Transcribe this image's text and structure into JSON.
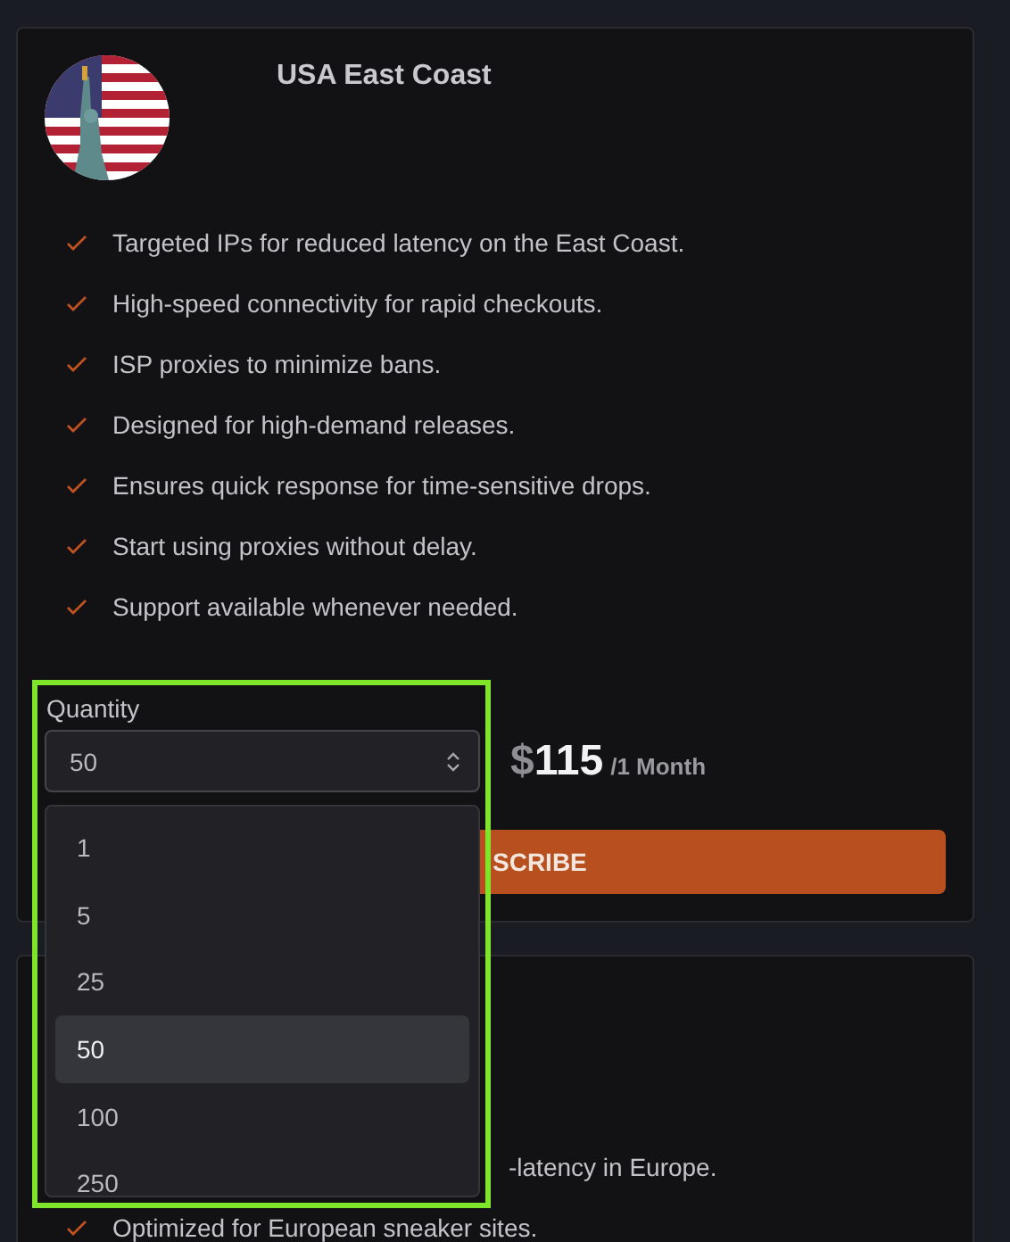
{
  "plan": {
    "title": "USA East Coast",
    "features": [
      "Targeted IPs for reduced latency on the East Coast.",
      "High-speed connectivity for rapid checkouts.",
      "ISP proxies to minimize bans.",
      "Designed for high-demand releases.",
      "Ensures quick response for time-sensitive drops.",
      "Start using proxies without delay.",
      "Support available whenever needed."
    ],
    "quantity": {
      "label": "Quantity",
      "value": "50",
      "expanded": true,
      "options": [
        {
          "label": "1",
          "selected": false
        },
        {
          "label": "5",
          "selected": false
        },
        {
          "label": "25",
          "selected": false
        },
        {
          "label": "50",
          "selected": true
        },
        {
          "label": "100",
          "selected": false
        },
        {
          "label": "250",
          "selected": false
        }
      ]
    },
    "price": {
      "currency": "$",
      "amount": "115",
      "period": "/1 Month"
    },
    "subscribe_button": "SCRIBE"
  },
  "next_plan": {
    "features": [
      {
        "kind": "partial",
        "text": "-latency in Europe."
      },
      {
        "kind": "full",
        "text": "Optimized for European sneaker sites."
      }
    ]
  },
  "highlight": {
    "on": true
  }
}
